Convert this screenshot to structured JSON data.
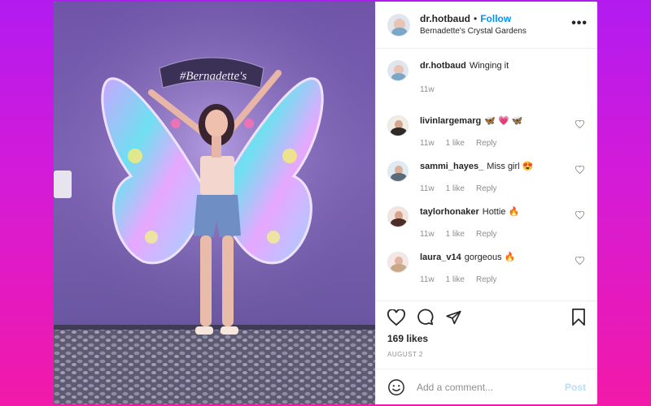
{
  "post": {
    "username": "dr.hotbaud",
    "separator": "•",
    "follow_label": "Follow",
    "location": "Bernadette's Crystal Gardens",
    "more_icon": "more-dots-icon",
    "sign_text": "#Bernadette's"
  },
  "comments": [
    {
      "user": "dr.hotbaud",
      "text": "Winging it",
      "time": "11w",
      "likes": "",
      "reply": ""
    },
    {
      "user": "livinlargemarg",
      "text": "🦋 💗 🦋",
      "time": "11w",
      "likes": "1 like",
      "reply": "Reply"
    },
    {
      "user": "sammi_hayes_",
      "text": "Miss girl 😍",
      "time": "11w",
      "likes": "1 like",
      "reply": "Reply"
    },
    {
      "user": "taylorhonaker",
      "text": "Hottie 🔥",
      "time": "11w",
      "likes": "1 like",
      "reply": "Reply"
    },
    {
      "user": "laura_v14",
      "text": "gorgeous 🔥",
      "time": "11w",
      "likes": "1 like",
      "reply": "Reply"
    }
  ],
  "actions": {
    "likes_text": "169 likes",
    "date_text": "AUGUST 2"
  },
  "composer": {
    "placeholder": "Add a comment...",
    "post_label": "Post"
  },
  "colors": {
    "accent": "#0095f6",
    "text": "#262626",
    "muted": "#8e8e8e",
    "bg_gradient_top": "#b21bf0",
    "bg_gradient_bottom": "#f21aa8"
  }
}
